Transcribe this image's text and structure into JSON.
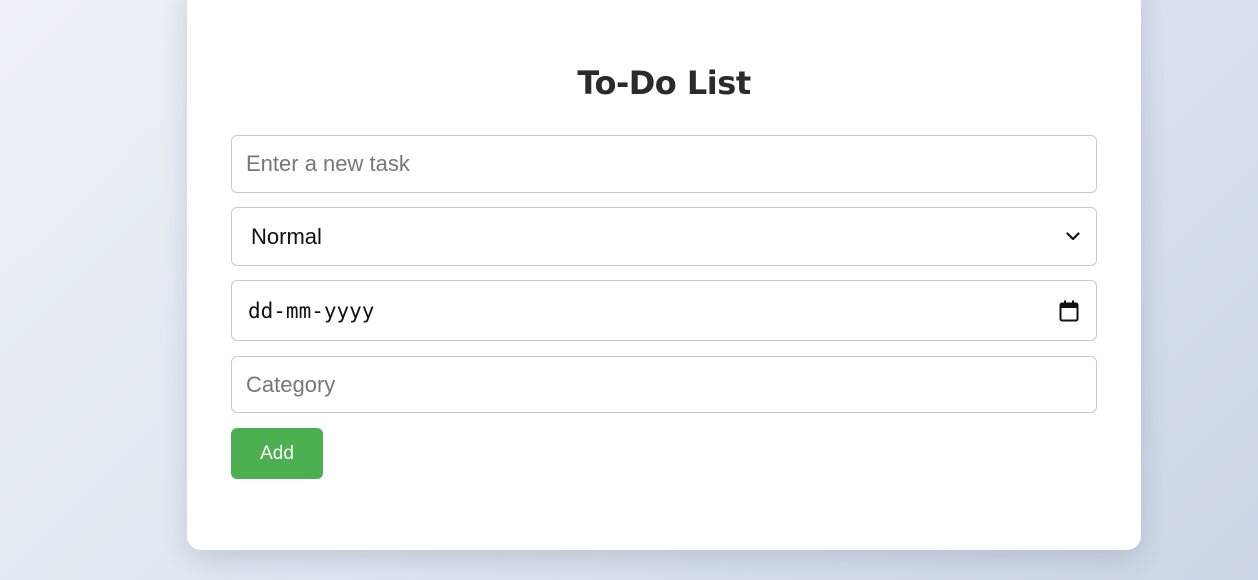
{
  "app": {
    "title": "To-Do List"
  },
  "form": {
    "task_placeholder": "Enter a new task",
    "task_value": "",
    "priority_selected": "Normal",
    "due_date_placeholder": "dd-mm-yyyy",
    "category_placeholder": "Category",
    "category_value": "",
    "add_label": "Add"
  },
  "icons": {
    "priority_dropdown": "chevron-down-icon",
    "date_picker": "calendar-icon"
  },
  "colors": {
    "add_button_bg": "#4caf50",
    "add_button_text": "#ffffff",
    "title_text": "#2b2b2b"
  }
}
